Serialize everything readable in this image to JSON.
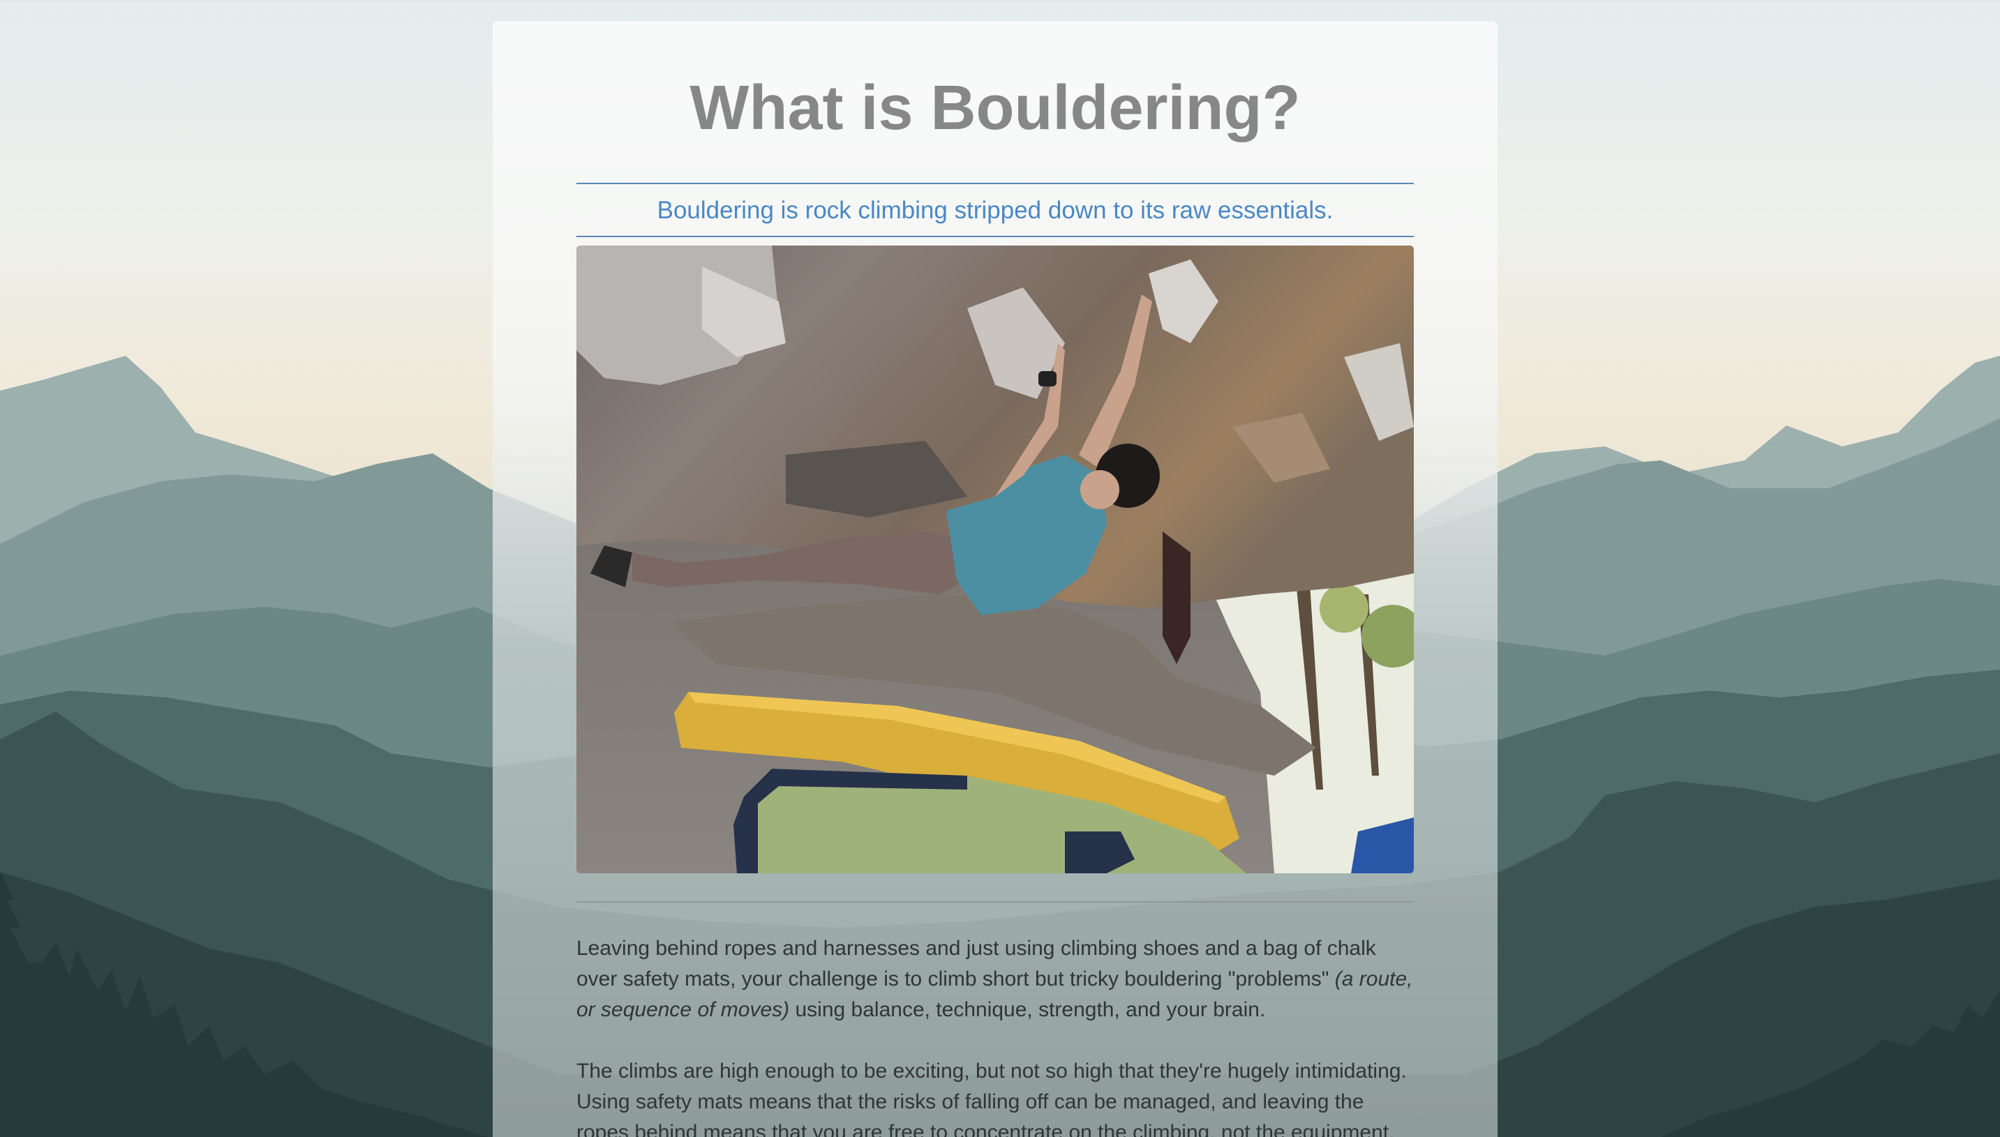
{
  "page": {
    "title": "What is Bouldering?",
    "subtitle": "Bouldering is rock climbing stripped down to its raw essentials."
  },
  "hero_image": {
    "subject": "climber on overhanging boulder above crash pads"
  },
  "paragraphs": [
    {
      "before": "Leaving behind ropes and harnesses and just using climbing shoes and a bag of chalk over safety mats, your challenge is to climb short but tricky bouldering \"problems\" ",
      "italic": "(a route, or sequence of moves)",
      "after": " using balance, technique, strength, and your brain."
    },
    {
      "text": "The climbs are high enough to be exciting, but not so high that they're hugely intimidating. Using safety mats means that the risks of falling off can be managed, and leaving the ropes behind means that you are free to concentrate on the climbing, not the equipment."
    }
  ],
  "colors": {
    "title": "#878787",
    "subtitle": "#4b87c4",
    "rule": "#5b88b4",
    "body_text": "#2f3535"
  }
}
